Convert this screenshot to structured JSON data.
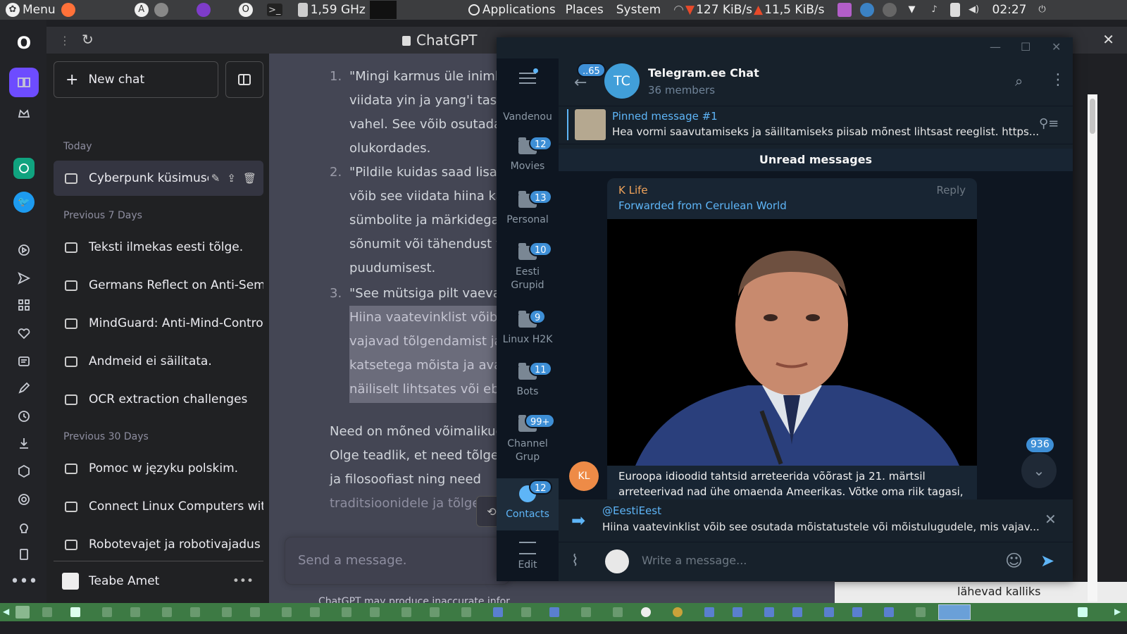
{
  "top_panel": {
    "menu_label": "Menu",
    "cpu_freq": "1,59 GHz",
    "applications": "Applications",
    "places": "Places",
    "system": "System",
    "net_down": "127 KiB/s",
    "net_up": "11,5 KiB/s",
    "time": "02:27"
  },
  "browser": {
    "tab_title": "ChatGPT"
  },
  "chatgpt": {
    "new_chat": "New chat",
    "groups": [
      {
        "label": "Today",
        "items": [
          "Cyberpunk küsimuse"
        ]
      },
      {
        "label": "Previous 7 Days",
        "items": [
          "Teksti ilmekas eesti tõlge.",
          "Germans Reflect on Anti-Semi",
          "MindGuard: Anti-Mind-Contro",
          "Andmeid ei säilitata.",
          "OCR extraction challenges"
        ]
      },
      {
        "label": "Previous 30 Days",
        "items": [
          "Pomoc w języku polskim.",
          "Connect Linux Computers with",
          "Robotevajet ja robotivajadus"
        ]
      }
    ],
    "user_name": "Teabe Amet",
    "content_lines": [
      "\"Mingi karmus üle inimli",
      "viidata yin ja yang'i tasak",
      "vahel. See võib osutada",
      "olukordades.",
      "\"Pildile kuidas saad lisac",
      "võib see viidata hiina kal",
      "sümbolite ja märkidega",
      "sõnumit või tähendust v",
      "puudumisest.",
      "\"See mütsiga pilt vaevalt",
      "Hiina vaatevinklist võib s",
      "vajavad tõlgendamist ja",
      "katsetega mõista ja avas",
      "näiliselt lihtsates või eba",
      "Need on mõned võimalikud",
      "Olge teadlik, et need tõlgen",
      "ja filosoofiast ning need",
      "traditsioonidele ja tõlgenda"
    ],
    "list_numbers": [
      "1.",
      "2.",
      "3."
    ],
    "input_placeholder": "Send a message.",
    "disclaimer": "ChatGPT may produce inaccurate infor"
  },
  "right_panel": {
    "caption": "lähevad kalliks"
  },
  "telegram": {
    "folders": [
      {
        "label": "Vandenou",
        "badge": ""
      },
      {
        "label": "Movies",
        "badge": "12"
      },
      {
        "label": "Personal",
        "badge": "13"
      },
      {
        "label": "Eesti Grupid",
        "badge": "10"
      },
      {
        "label": "Linux H2K",
        "badge": "9"
      },
      {
        "label": "Bots",
        "badge": "11"
      },
      {
        "label": "Channel Grup",
        "badge": "99+"
      },
      {
        "label": "Contacts",
        "badge": "12"
      },
      {
        "label": "Edit",
        "badge": ""
      }
    ],
    "back_badge": "..65",
    "chat_avatar": "TC",
    "chat_name": "Telegram.ee Chat",
    "chat_members": "36 members",
    "pinned_title": "Pinned message #1",
    "pinned_text": "Hea vormi saavutamiseks ja säilitamiseks piisab mõnest lihtsast reeglist. https...",
    "unread_label": "Unread messages",
    "message": {
      "sender": "K Life",
      "reply": "Reply",
      "forwarded": "Forwarded from Cerulean World",
      "avatar": "KL",
      "text_line1": "Euroopa idioodid tahtsid arreteerida võõrast ja 21. märtsil",
      "text_line2": "arreteerivad nad ühe omaenda Ameerikas. Võtke oma riik tagasi,"
    },
    "unread_count": "936",
    "reply_to": "@EestiEest",
    "reply_text": "Hiina vaatevinklist võib see osutada mõistatustele või mõistulugudele, mis vajav...",
    "input_placeholder": "Write a message..."
  }
}
